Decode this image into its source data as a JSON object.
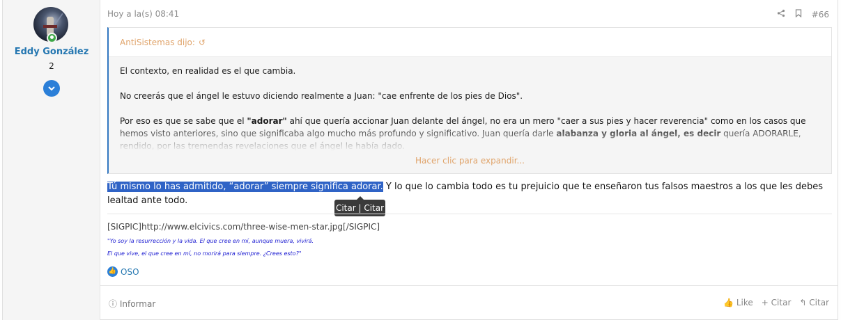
{
  "user": {
    "name": "Eddy González",
    "message_count": "2",
    "expand_icon": "chevron-down-icon"
  },
  "post": {
    "date": "Hoy a la(s) 08:41",
    "number": "#66",
    "share_icon": "share-icon",
    "bookmark_icon": "bookmark-icon"
  },
  "quote": {
    "author": "AntiSistemas dijo:",
    "back_icon": "↺",
    "paragraphs": [
      "El contexto, en realidad es el que cambia.",
      "No creerás que el ángel le estuvo diciendo realmente a Juan: \"cae enfrente de los pies de Dios\".",
      "Por eso es que se sabe que el"
    ],
    "p3_bold1": "\"adorar\"",
    "p3_mid": " ahí que quería accionar Juan delante del ángel, no era un mero \"caer a sus pies y hacer reverencia\" como en los casos que hemos visto anteriores, sino que significaba algo mucho más profundo y significativo. Juan quería darle ",
    "p3_bold2": "alabanza y gloria al ángel, es decir",
    "p3_end": " quería ADORARLE, rendido, por las tremendas revelaciones que el ángel le había dado.",
    "expand_label": "Hacer clic para expandir..."
  },
  "reply": {
    "selected_text": "Tú mismo lo has admitido, “adorar” siempre significa adorar.",
    "rest_text": " Y lo que lo cambia todo es tu prejuicio que te enseñaron tus falsos maestros a los que les debes lealtad ante todo."
  },
  "tooltip": {
    "label": "Citar | Citar"
  },
  "signature": {
    "pic": "[SIGPIC]http://www.elcivics.com/three-wise-men-star.jpg[/SIGPIC]",
    "quote1": "\"Yo soy la resurrección y la vida. El que cree en mí, aunque muera, vivirá.",
    "quote2": "El que vive, el que cree en mí, no morirá para siempre. ¿Crees esto?\""
  },
  "reactions": {
    "who": "OSO"
  },
  "footer": {
    "report": "Informar",
    "like": "Like",
    "quote_multi": "Citar",
    "reply_quote": "Citar"
  }
}
